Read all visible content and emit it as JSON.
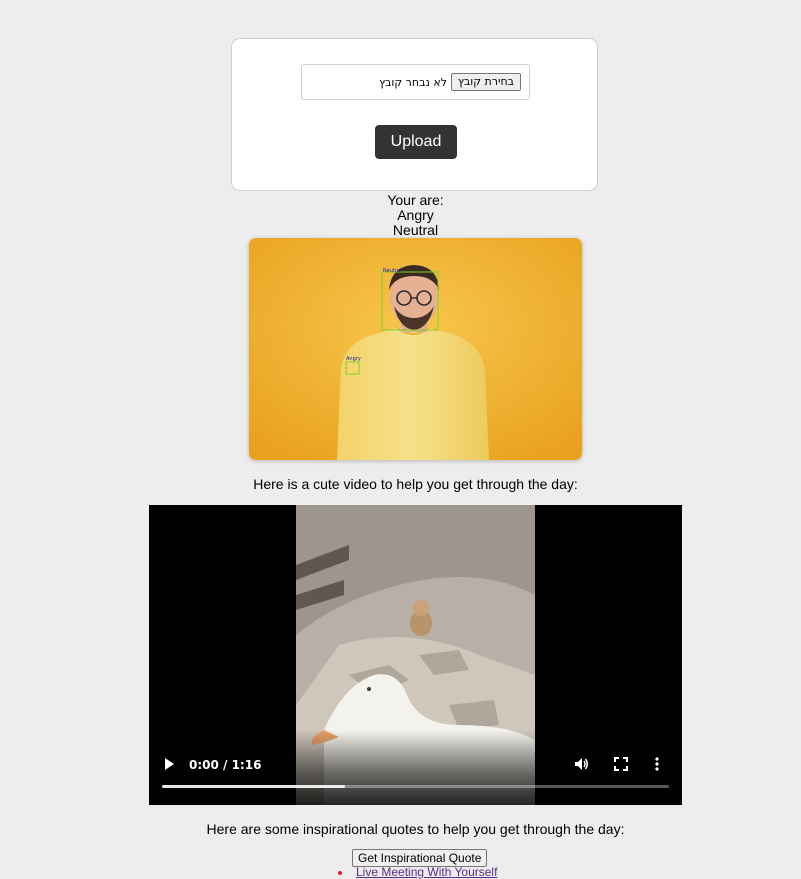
{
  "upload": {
    "choose_file_label": "בחירת קובץ",
    "no_file_text": "לא נבחר קובץ",
    "upload_label": "Upload"
  },
  "result": {
    "heading": "Your are:",
    "emotions": [
      "Angry",
      "Neutral"
    ],
    "detection_labels": [
      "Neutral",
      "Angry"
    ]
  },
  "video": {
    "caption": "Here is a cute video to help you get through the day:",
    "time": "0:00 / 1:16",
    "buffered_fraction": 0.36
  },
  "quotes": {
    "caption": "Here are some inspirational quotes to help you get through the day:",
    "button_label": "Get Inspirational Quote",
    "items": [
      "Live Meeting With Yourself"
    ]
  },
  "colors": {
    "page_bg": "#ededed",
    "upload_button_bg": "#333333",
    "detection_box": "#7ed321",
    "detection_label": "#1a1aa6",
    "quote_link": "#5a2a8c",
    "bullet": "#e3241a"
  }
}
